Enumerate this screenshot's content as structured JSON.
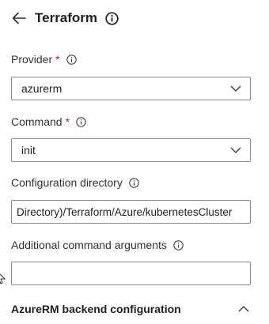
{
  "header": {
    "title": "Terraform"
  },
  "provider": {
    "label": "Provider",
    "required_marker": "*",
    "value": "azurerm"
  },
  "command": {
    "label": "Command",
    "required_marker": "*",
    "value": "init"
  },
  "config_directory": {
    "label": "Configuration directory",
    "value": "Directory)/Terraform/Azure/kubernetesCluster"
  },
  "command_args": {
    "label": "Additional command arguments",
    "value": ""
  },
  "backend_section": {
    "title": "AzureRM backend configuration"
  },
  "icons": {
    "back": "arrow-left-icon",
    "info": "info-icon",
    "dropdown": "chevron-down-icon",
    "collapse": "chevron-up-icon"
  },
  "colors": {
    "required": "#a4262c",
    "border": "#8a8886",
    "text": "#323130"
  }
}
